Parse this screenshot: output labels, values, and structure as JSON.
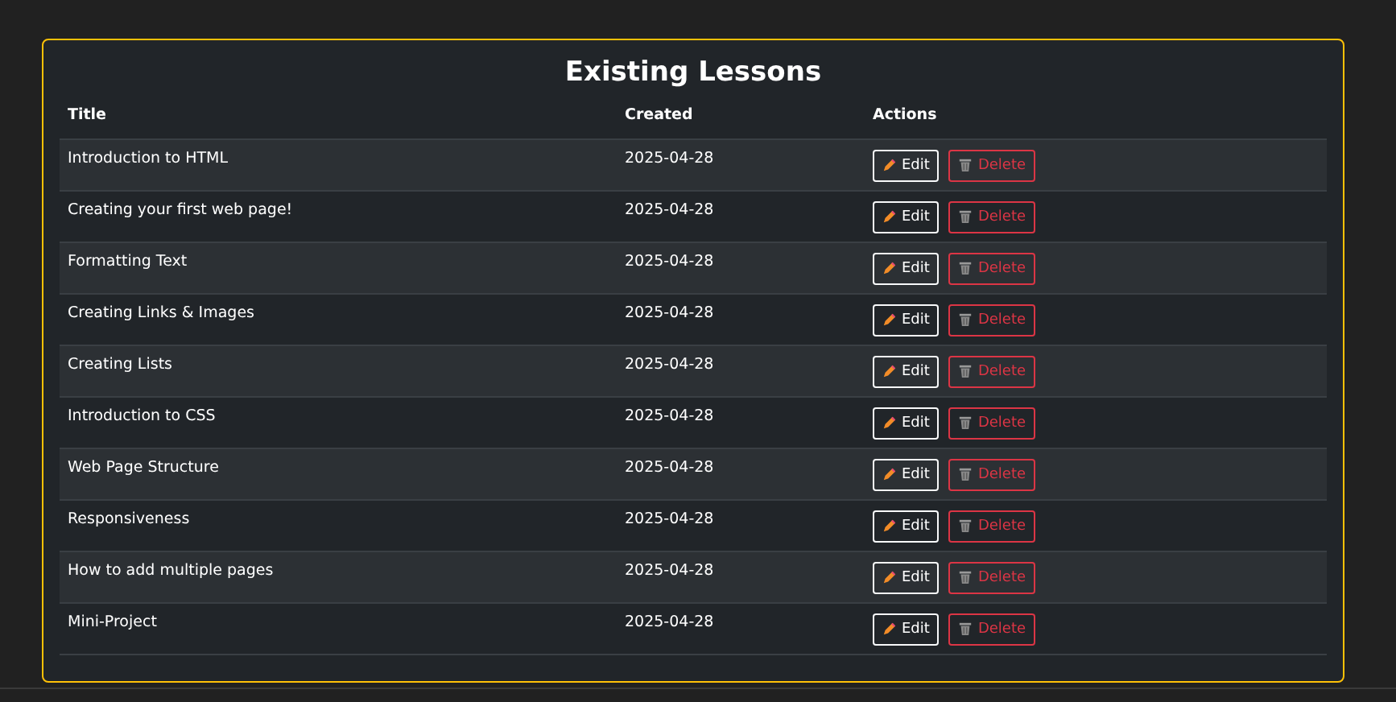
{
  "heading": "Existing Lessons",
  "columns": [
    "Title",
    "Created",
    "Actions"
  ],
  "rows": [
    {
      "title": "Introduction to HTML",
      "created": "2025-04-28",
      "edit": "Edit",
      "delete": "Delete"
    },
    {
      "title": "Creating your first web page!",
      "created": "2025-04-28",
      "edit": "Edit",
      "delete": "Delete"
    },
    {
      "title": "Formatting Text",
      "created": "2025-04-28",
      "edit": "Edit",
      "delete": "Delete"
    },
    {
      "title": "Creating Links & Images",
      "created": "2025-04-28",
      "edit": "Edit",
      "delete": "Delete"
    },
    {
      "title": "Creating Lists",
      "created": "2025-04-28",
      "edit": "Edit",
      "delete": "Delete"
    },
    {
      "title": "Introduction to CSS",
      "created": "2025-04-28",
      "edit": "Edit",
      "delete": "Delete"
    },
    {
      "title": "Web Page Structure",
      "created": "2025-04-28",
      "edit": "Edit",
      "delete": "Delete"
    },
    {
      "title": "Responsiveness",
      "created": "2025-04-28",
      "edit": "Edit",
      "delete": "Delete"
    },
    {
      "title": "How to add multiple pages",
      "created": "2025-04-28",
      "edit": "Edit",
      "delete": "Delete"
    },
    {
      "title": "Mini-Project",
      "created": "2025-04-28",
      "edit": "Edit",
      "delete": "Delete"
    }
  ]
}
